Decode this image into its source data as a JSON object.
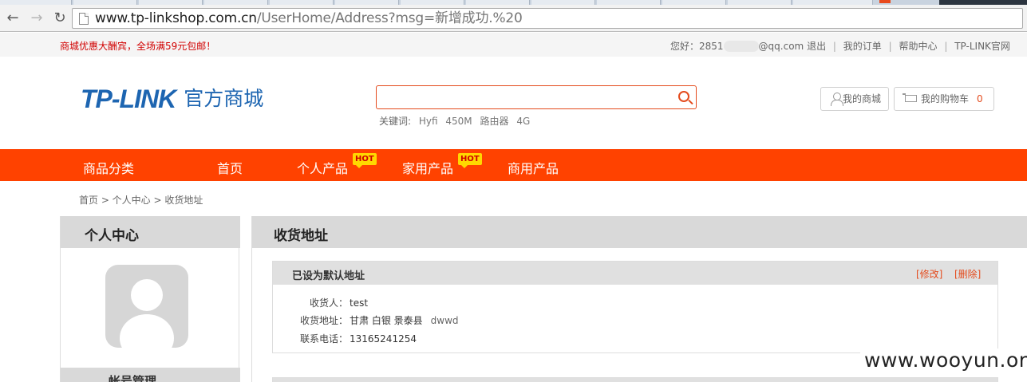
{
  "browser": {
    "url_host": "www.tp-linkshop.com.cn",
    "url_path": "/UserHome/Address?msg=新增成功.%20",
    "back_icon": "arrow-left-icon",
    "forward_icon": "arrow-right-icon",
    "reload_icon": "reload-icon"
  },
  "topbar": {
    "promo_text": "商城优惠大酬宾，全场满59元包邮！",
    "greeting": "您好：2851",
    "email_tail": "@qq.com",
    "logout": "退出",
    "links": [
      "我的订单",
      "帮助中心",
      "TP-LINK官网"
    ]
  },
  "header": {
    "logo_main": "TP-LINK",
    "logo_sub": "官方商城",
    "search_placeholder": "",
    "keywords_label": "关键词:",
    "keywords": [
      "Hyfi",
      "450M",
      "路由器",
      "4G"
    ],
    "my_mall": "我的商城",
    "my_cart": "我的购物车",
    "cart_count": "0"
  },
  "nav": {
    "items": [
      "商品分类",
      "首页",
      "个人产品",
      "家用产品",
      "商用产品"
    ],
    "hot_label": "HOT"
  },
  "breadcrumb": "首页 > 个人中心 > 收货地址",
  "sidebar": {
    "title": "个人中心",
    "next_section": "帐号管理"
  },
  "main": {
    "title": "收货地址",
    "address": {
      "status": "已设为默认地址",
      "edit": "[修改]",
      "delete": "[删除]",
      "recipient_label": "收货人：",
      "recipient": "test",
      "address_label": "收货地址：",
      "region": "甘肃 白银 景泰县",
      "detail": "dwwd",
      "phone_label": "联系电话：",
      "phone": "13165241254"
    }
  },
  "watermark": "www.wooyun.org",
  "colors": {
    "brand_blue": "#1d65b1",
    "nav_orange": "#ff4200",
    "link_orange": "#e44b1d",
    "hot_yellow": "#ffd800"
  }
}
